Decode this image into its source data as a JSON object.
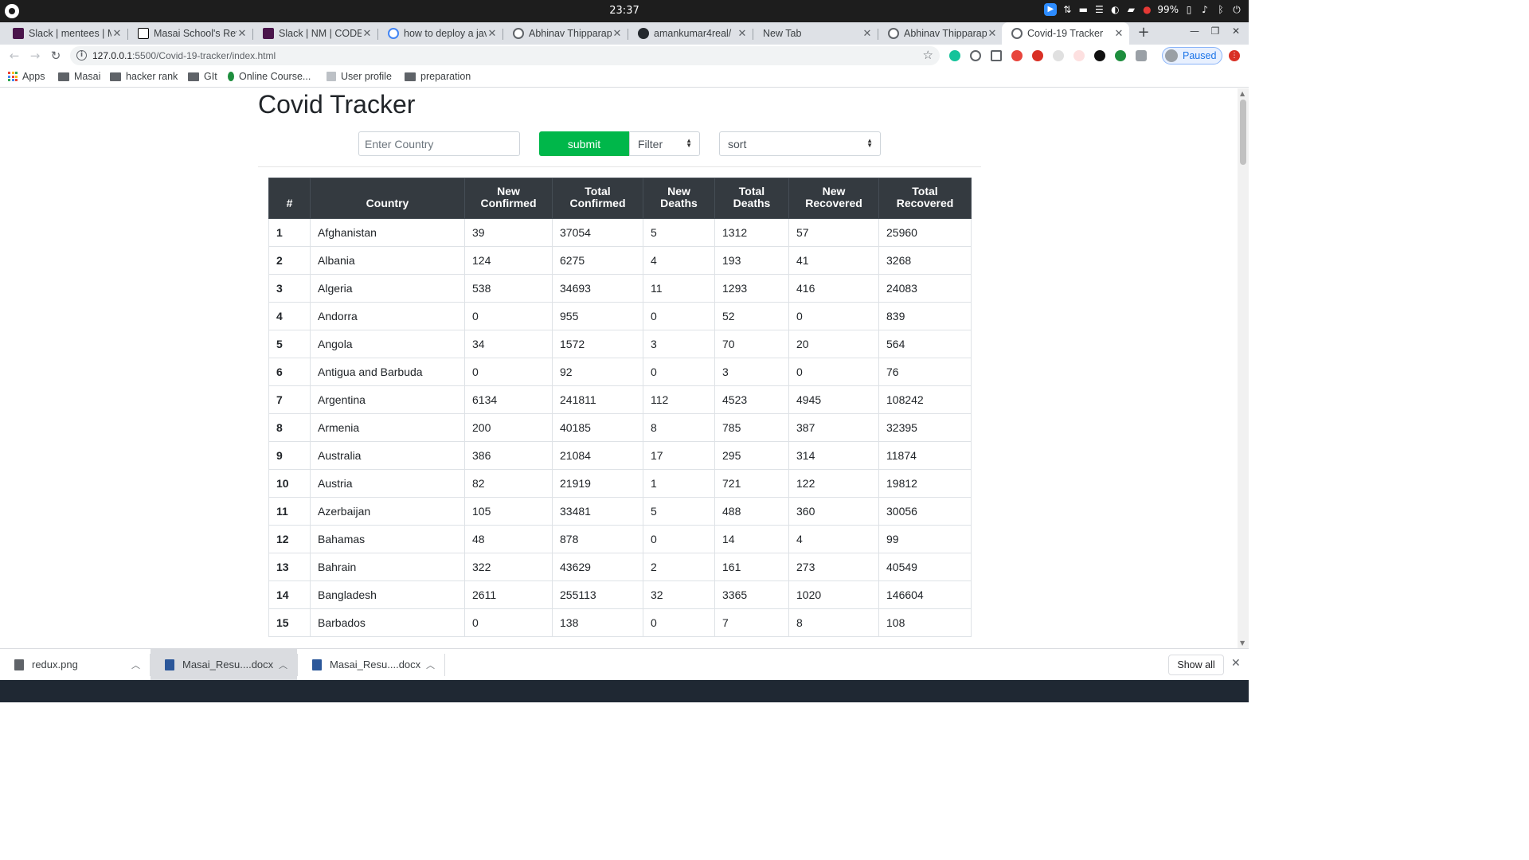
{
  "os": {
    "clock": "23:37",
    "battery": "99%"
  },
  "tabs": [
    {
      "title": "Slack | mentees | M",
      "favicon": "slack-icon",
      "color": "#4a154b"
    },
    {
      "title": "Masai School's Rev",
      "favicon": "notion-icon",
      "color": "#000000"
    },
    {
      "title": "Slack | NM | CODEF",
      "favicon": "slack-icon",
      "color": "#4a154b"
    },
    {
      "title": "how to deploy a jav",
      "favicon": "google-icon",
      "color": "#4285f4"
    },
    {
      "title": "Abhinav Thipparap",
      "favicon": "globe-icon",
      "color": "#5f6368"
    },
    {
      "title": "amankumar4real/",
      "favicon": "github-icon",
      "color": "#24292e"
    },
    {
      "title": "New Tab",
      "favicon": "",
      "color": ""
    },
    {
      "title": "Abhinav Thipparap",
      "favicon": "globe-icon",
      "color": "#5f6368"
    },
    {
      "title": "Covid-19 Tracker",
      "favicon": "globe-icon",
      "color": "#5f6368"
    }
  ],
  "toolbar": {
    "url_host": "127.0.0.1",
    "url_rest": ":5500/Covid-19-tracker/index.html",
    "profile_label": "Paused"
  },
  "bookmarks": [
    "Apps",
    "Masai",
    "hacker rank",
    "GIt",
    "Online Course...",
    "User profile",
    "preparation"
  ],
  "page": {
    "title": "Covid Tracker",
    "search_placeholder": "Enter Country",
    "submit_label": "submit",
    "filter_label": "Filter",
    "sort_label": "sort"
  },
  "table": {
    "headers": [
      [
        "#"
      ],
      [
        "Country"
      ],
      [
        "New",
        "Confirmed"
      ],
      [
        "Total",
        "Confirmed"
      ],
      [
        "New",
        "Deaths"
      ],
      [
        "Total",
        "Deaths"
      ],
      [
        "New",
        "Recovered"
      ],
      [
        "Total",
        "Recovered"
      ]
    ],
    "rows": [
      [
        "1",
        "Afghanistan",
        "39",
        "37054",
        "5",
        "1312",
        "57",
        "25960"
      ],
      [
        "2",
        "Albania",
        "124",
        "6275",
        "4",
        "193",
        "41",
        "3268"
      ],
      [
        "3",
        "Algeria",
        "538",
        "34693",
        "11",
        "1293",
        "416",
        "24083"
      ],
      [
        "4",
        "Andorra",
        "0",
        "955",
        "0",
        "52",
        "0",
        "839"
      ],
      [
        "5",
        "Angola",
        "34",
        "1572",
        "3",
        "70",
        "20",
        "564"
      ],
      [
        "6",
        "Antigua and Barbuda",
        "0",
        "92",
        "0",
        "3",
        "0",
        "76"
      ],
      [
        "7",
        "Argentina",
        "6134",
        "241811",
        "112",
        "4523",
        "4945",
        "108242"
      ],
      [
        "8",
        "Armenia",
        "200",
        "40185",
        "8",
        "785",
        "387",
        "32395"
      ],
      [
        "9",
        "Australia",
        "386",
        "21084",
        "17",
        "295",
        "314",
        "11874"
      ],
      [
        "10",
        "Austria",
        "82",
        "21919",
        "1",
        "721",
        "122",
        "19812"
      ],
      [
        "11",
        "Azerbaijan",
        "105",
        "33481",
        "5",
        "488",
        "360",
        "30056"
      ],
      [
        "12",
        "Bahamas",
        "48",
        "878",
        "0",
        "14",
        "4",
        "99"
      ],
      [
        "13",
        "Bahrain",
        "322",
        "43629",
        "2",
        "161",
        "273",
        "40549"
      ],
      [
        "14",
        "Bangladesh",
        "2611",
        "255113",
        "32",
        "3365",
        "1020",
        "146604"
      ],
      [
        "15",
        "Barbados",
        "0",
        "138",
        "0",
        "7",
        "8",
        "108"
      ]
    ]
  },
  "downloads": [
    "redux.png",
    "Masai_Resu....docx",
    "Masai_Resu....docx"
  ],
  "downloads_show_all": "Show all"
}
